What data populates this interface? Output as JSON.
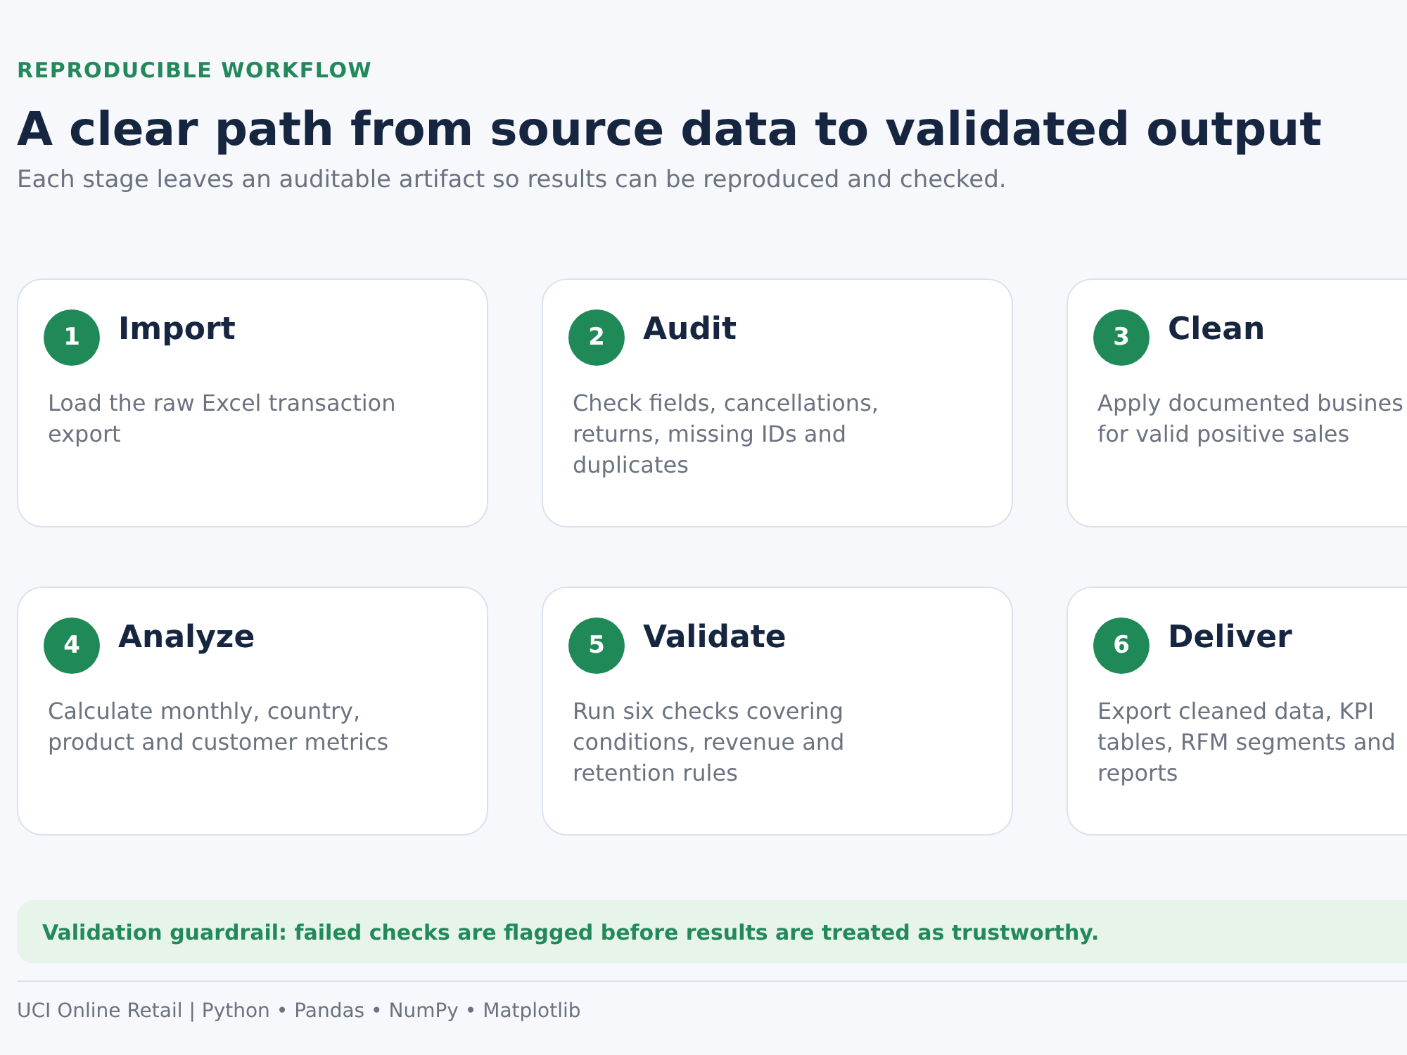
{
  "eyebrow": "REPRODUCIBLE WORKFLOW",
  "title": "A clear path from source data to validated output",
  "subtitle": "Each stage leaves an auditable artifact so results can be reproduced and checked.",
  "stages": [
    {
      "number": "1",
      "name": "Import",
      "lines": [
        "Load the raw Excel transaction",
        "export"
      ]
    },
    {
      "number": "2",
      "name": "Audit",
      "lines": [
        "Check fields, cancellations,",
        "returns, missing IDs and",
        "duplicates"
      ]
    },
    {
      "number": "3",
      "name": "Clean",
      "lines": [
        "Apply documented busines",
        "for valid positive sales"
      ]
    },
    {
      "number": "4",
      "name": "Analyze",
      "lines": [
        "Calculate monthly, country,",
        "product and customer metrics"
      ]
    },
    {
      "number": "5",
      "name": "Validate",
      "lines": [
        "Run six checks covering",
        "conditions, revenue and",
        "retention rules"
      ]
    },
    {
      "number": "6",
      "name": "Deliver",
      "lines": [
        "Export cleaned data, KPI",
        "tables, RFM segments and",
        "reports"
      ]
    }
  ],
  "guardrail": "Validation guardrail: failed checks are flagged before results are treated as trustworthy.",
  "footer": "UCI Online Retail | Python • Pandas • NumPy • Matplotlib"
}
